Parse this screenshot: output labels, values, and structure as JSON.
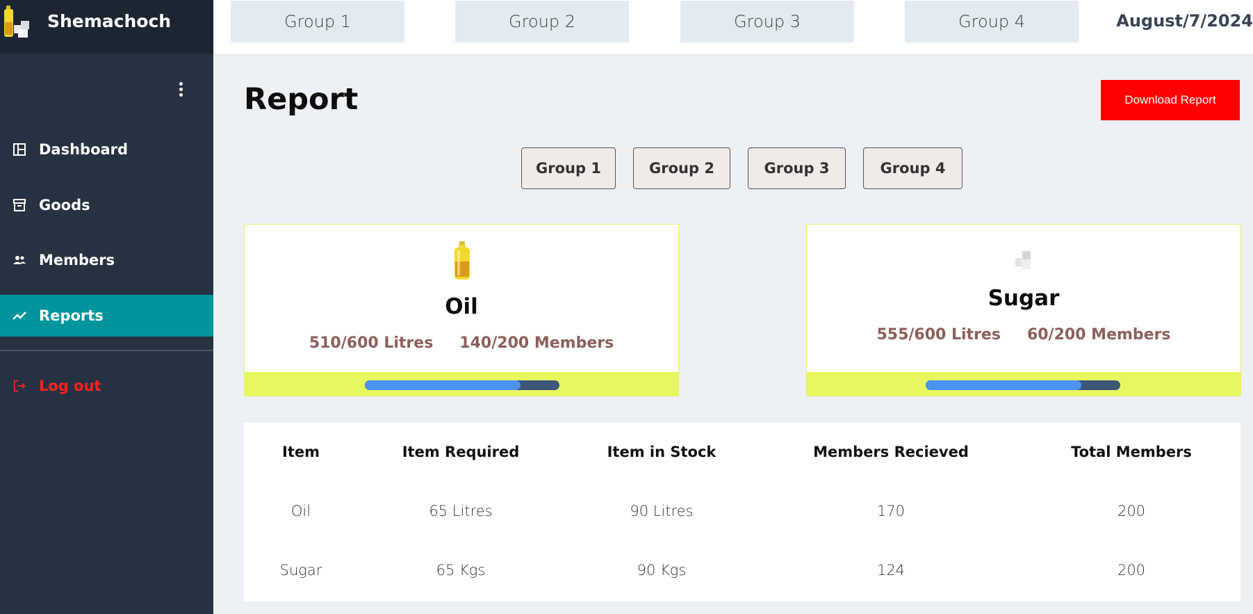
{
  "brand": {
    "name": "Shemachoch"
  },
  "sidebar": {
    "items": [
      {
        "label": "Dashboard",
        "icon": "dashboard-icon"
      },
      {
        "label": "Goods",
        "icon": "archive-icon"
      },
      {
        "label": "Members",
        "icon": "people-icon"
      },
      {
        "label": "Reports",
        "icon": "trend-icon",
        "active": true
      }
    ],
    "logout_label": "Log out"
  },
  "topbar": {
    "groups": [
      "Group 1",
      "Group 2",
      "Group 3",
      "Group 4"
    ],
    "date": "August/7/2024"
  },
  "main": {
    "title": "Report",
    "download_label": "Download Report",
    "filters": [
      "Group 1",
      "Group 2",
      "Group 3",
      "Group 4"
    ],
    "cards": [
      {
        "title": "Oil",
        "stock": "510/600 Litres",
        "members": "140/200 Members",
        "icon": "oil-bottle-icon",
        "progress": 0.8
      },
      {
        "title": "Sugar",
        "stock": "555/600 Litres",
        "members": "60/200 Members",
        "icon": "sugar-cubes-icon",
        "progress": 0.8
      }
    ],
    "table": {
      "headers": [
        "Item",
        "Item Required",
        "Item in Stock",
        "Members Recieved",
        "Total Members"
      ],
      "rows": [
        [
          "Oil",
          "65 Litres",
          "90 Litres",
          "170",
          "200"
        ],
        [
          "Sugar",
          "65 Kgs",
          "90 Kgs",
          "124",
          "200"
        ]
      ]
    }
  },
  "colors": {
    "sidebar": "#263241",
    "active": "#00949c",
    "accent_red": "#ff0000",
    "card_footer": "#e8f760",
    "progress_fill": "#4b93ee",
    "progress_track": "#3c5678"
  }
}
